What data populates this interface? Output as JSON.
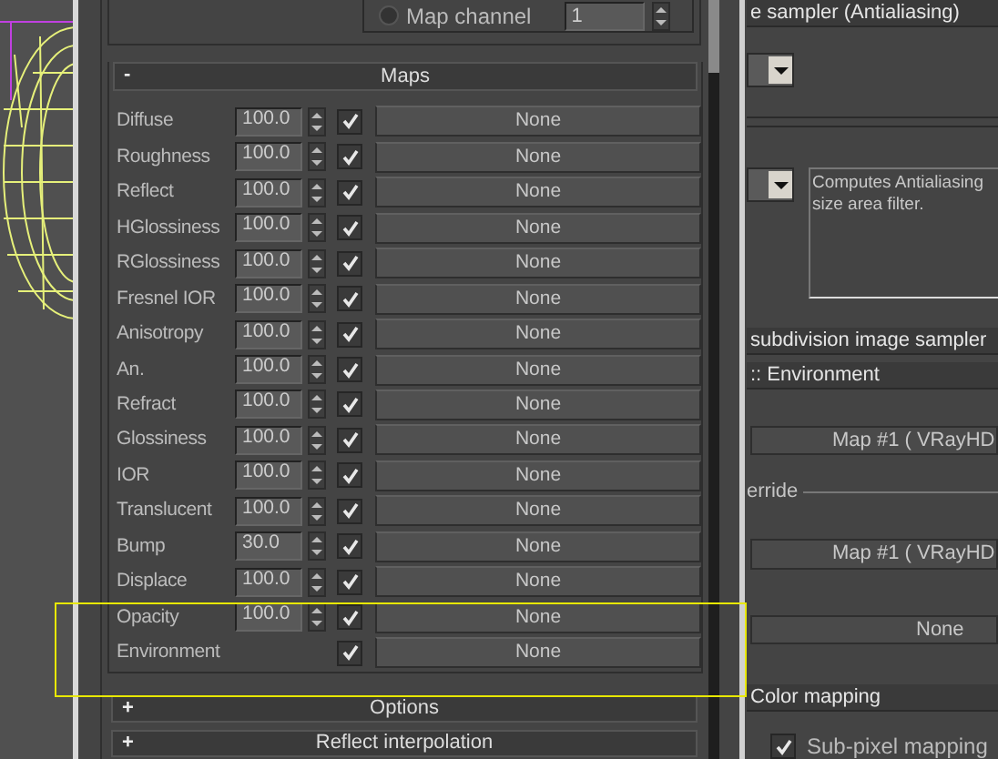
{
  "material_panel": {
    "map_channel": {
      "label": "Map channel",
      "selected": false,
      "value": "1"
    },
    "maps_rollout": {
      "sign": "-",
      "title": "Maps"
    },
    "maps": [
      {
        "label": "Diffuse",
        "amount": "100.0",
        "enabled": true,
        "map": "None"
      },
      {
        "label": "Roughness",
        "amount": "100.0",
        "enabled": true,
        "map": "None"
      },
      {
        "label": "Reflect",
        "amount": "100.0",
        "enabled": true,
        "map": "None"
      },
      {
        "label": "HGlossiness",
        "amount": "100.0",
        "enabled": true,
        "map": "None"
      },
      {
        "label": "RGlossiness",
        "amount": "100.0",
        "enabled": true,
        "map": "None"
      },
      {
        "label": "Fresnel IOR",
        "amount": "100.0",
        "enabled": true,
        "map": "None"
      },
      {
        "label": "Anisotropy",
        "amount": "100.0",
        "enabled": true,
        "map": "None"
      },
      {
        "label": "An.",
        "amount": "100.0",
        "enabled": true,
        "map": "None"
      },
      {
        "label": "Refract",
        "amount": "100.0",
        "enabled": true,
        "map": "None"
      },
      {
        "label": "Glossiness",
        "amount": "100.0",
        "enabled": true,
        "map": "None"
      },
      {
        "label": "IOR",
        "amount": "100.0",
        "enabled": true,
        "map": "None"
      },
      {
        "label": "Translucent",
        "amount": "100.0",
        "enabled": true,
        "map": "None"
      },
      {
        "label": "Bump",
        "amount": "30.0",
        "enabled": true,
        "map": "None"
      },
      {
        "label": "Displace",
        "amount": "100.0",
        "enabled": true,
        "map": "None"
      },
      {
        "label": "Opacity",
        "amount": "100.0",
        "enabled": true,
        "map": "None"
      },
      {
        "label": "Environment",
        "enabled": true,
        "map": "None"
      }
    ],
    "collapsed_rollouts": [
      {
        "sign": "+",
        "title": "Options"
      },
      {
        "sign": "+",
        "title": "Reflect interpolation"
      }
    ]
  },
  "render_panel": {
    "sampler_header": "e sampler (Antialiasing)",
    "filter_description": [
      "Computes Antialiasing",
      "size area filter."
    ],
    "subdivision_header": "subdivision image sampler",
    "environment_header": ":: Environment",
    "environment_map": "Map #1  ( VRayHD",
    "override_group": "erride",
    "override_map": "Map #1  ( VRayHD",
    "map_button": "None",
    "color_mapping_header": "Color mapping",
    "sub_pixel_mapping": {
      "label": "Sub-pixel mapping",
      "checked": true
    }
  }
}
